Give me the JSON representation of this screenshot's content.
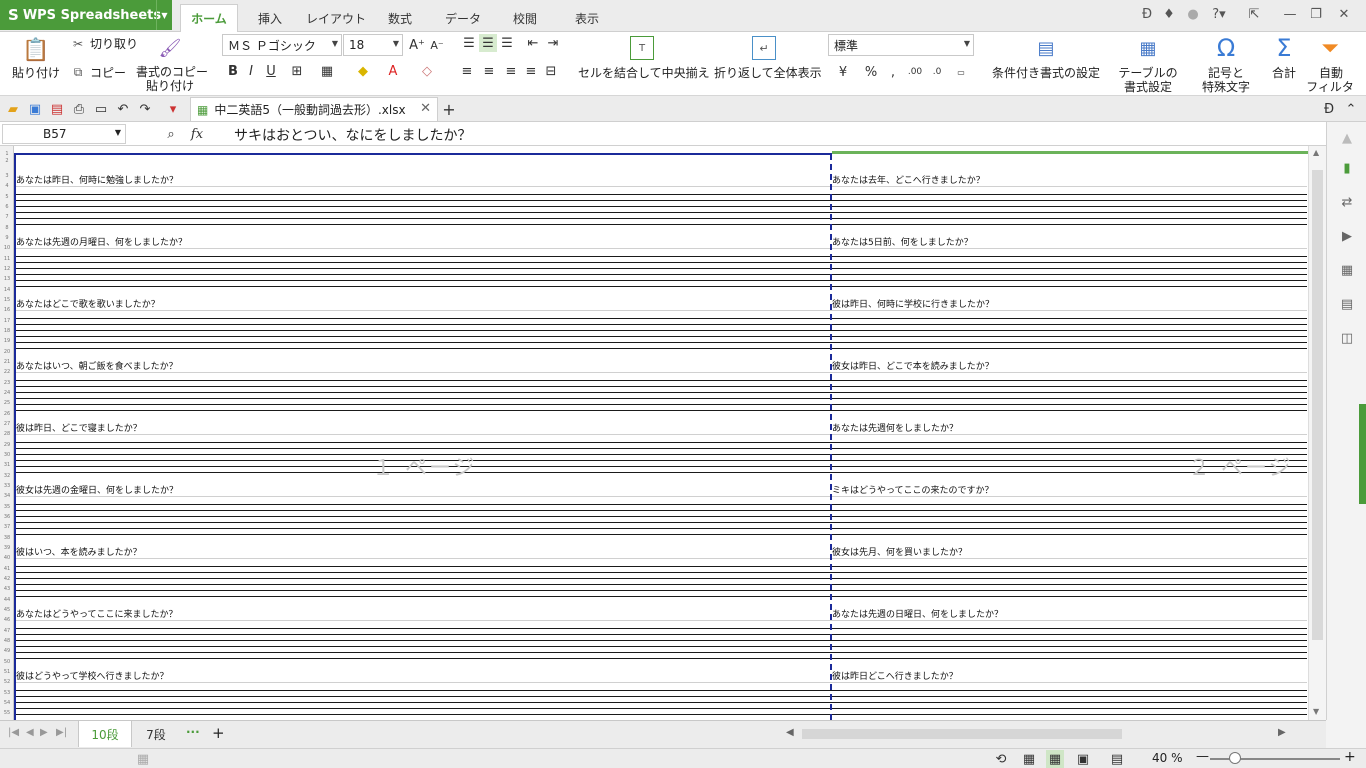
{
  "app": {
    "name": "WPS Spreadsheets",
    "logo_glyph": "S"
  },
  "ribbon_tabs": [
    "ホーム",
    "挿入",
    "レイアウト",
    "数式",
    "データ",
    "校閲",
    "表示"
  ],
  "active_tab": "ホーム",
  "ribbon": {
    "paste": "貼り付け",
    "cut": "切り取り",
    "copy": "コピー",
    "format_copy_line1": "書式のコピー",
    "format_copy_line2": "貼り付け",
    "font_name": "ＭＳ Ｐゴシック",
    "font_size": "18",
    "merge_center": "セルを結合して中央揃え",
    "wrap_text": "折り返して全体表示",
    "number_format": "標準",
    "percent": "%",
    "conditional_format": "条件付き書式の設定",
    "table_style_line1": "テーブルの",
    "table_style_line2": "書式設定",
    "symbol_line1": "記号と",
    "symbol_line2": "特殊文字",
    "sum": "合計",
    "autofilter_line1": "自動",
    "autofilter_line2": "フィルタ",
    "bold": "B",
    "italic": "I",
    "underline": "U"
  },
  "document": {
    "tab_title": "中二英語5（一般動詞過去形）.xlsx"
  },
  "formula_bar": {
    "cell_ref": "B57",
    "fx": "fx",
    "content": "サキはおとつい、なにをしましたか？"
  },
  "sheet": {
    "column_left": [
      {
        "row": "3",
        "text": "あなたは昨日、何時に勉強しましたか？"
      },
      {
        "row": "9",
        "text": "あなたは先週の月曜日、何をしましたか？"
      },
      {
        "row": "15",
        "text": "あなたはどこで歌を歌いましたか？"
      },
      {
        "row": "21",
        "text": "あなたはいつ、朝ご飯を食べましたか？"
      },
      {
        "row": "27",
        "text": "彼は昨日、どこで寝ましたか？"
      },
      {
        "row": "33",
        "text": "彼女は先週の金曜日、何をしましたか？"
      },
      {
        "row": "39",
        "text": "彼はいつ、本を読みましたか？"
      },
      {
        "row": "45",
        "text": "あなたはどうやってここに来ましたか？"
      },
      {
        "row": "51",
        "text": "彼はどうやって学校へ行きましたか？"
      }
    ],
    "column_right": [
      {
        "row": "3",
        "text": "あなたは去年、どこへ行きましたか？"
      },
      {
        "row": "9",
        "text": "あなたは5日前、何をしましたか？"
      },
      {
        "row": "15",
        "text": "彼は昨日、何時に学校に行きましたか？"
      },
      {
        "row": "21",
        "text": "彼女は昨日、どこで本を読みましたか？"
      },
      {
        "row": "27",
        "text": "あなたは先週何をしましたか？"
      },
      {
        "row": "33",
        "text": "ミキはどうやってここの来たのですか？"
      },
      {
        "row": "39",
        "text": "彼女は先月、何を買いましたか？"
      },
      {
        "row": "45",
        "text": "あなたは先週の日曜日、何をしましたか？"
      },
      {
        "row": "51",
        "text": "彼は昨日どこへ行きましたか？"
      }
    ],
    "page1_label": "１ ページ",
    "page2_label": "２ ページ"
  },
  "sheet_tabs": [
    "10段",
    "7段"
  ],
  "active_sheet": "10段",
  "status": {
    "zoom": "40 %"
  },
  "colors": {
    "accent": "#4b9b3a",
    "page_border": "#1b2a9a"
  }
}
